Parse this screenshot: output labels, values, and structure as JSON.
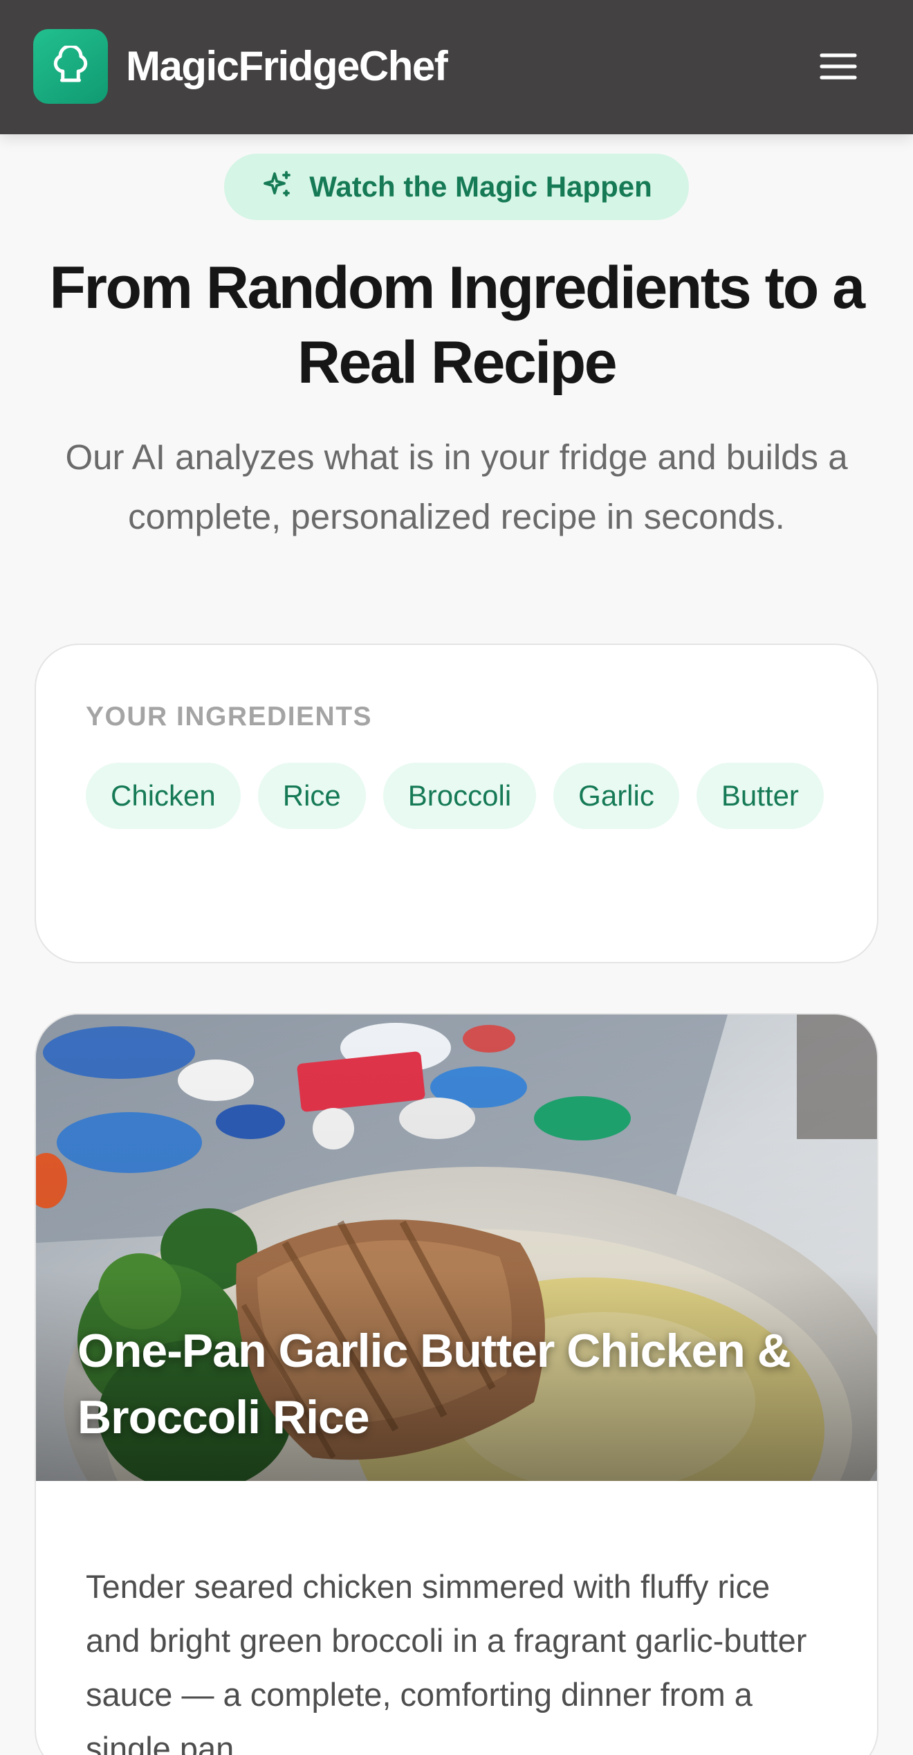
{
  "header": {
    "brand": "MagicFridgeChef",
    "logo_icon": "chef-hat-icon",
    "menu_icon": "hamburger-menu-icon"
  },
  "hero": {
    "badge_icon": "sparkles-icon",
    "badge_label": "Watch the Magic Happen",
    "title": "From Random Ingredients to a Real Recipe",
    "subtitle": "Our AI analyzes what is in your fridge and builds a complete, personalized recipe in seconds."
  },
  "ingredients": {
    "label": "YOUR INGREDIENTS",
    "items": [
      "Chicken",
      "Rice",
      "Broccoli",
      "Garlic",
      "Butter"
    ]
  },
  "recipe": {
    "title": "One-Pan Garlic Butter Chicken & Broccoli Rice",
    "description": "Tender seared chicken simmered with fluffy rice and bright green broccoli in a fragrant garlic-butter sauce — a complete, comforting dinner from a single pan."
  },
  "colors": {
    "header_bg": "#434141",
    "accent": "#157a55",
    "accent_light": "#d5f5e6",
    "chip_bg": "#e9faf2",
    "logo_gradient": [
      "#22c08e",
      "#109a72"
    ]
  }
}
